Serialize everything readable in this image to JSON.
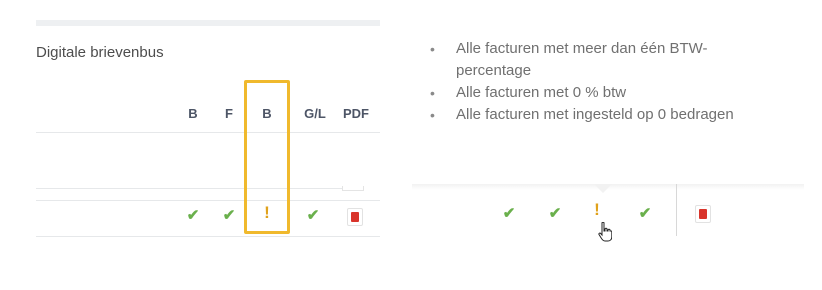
{
  "left": {
    "title": "Digitale brievenbus",
    "columns": [
      "B",
      "F",
      "B",
      "G/L",
      "PDF"
    ],
    "row_status": [
      "check",
      "check",
      "warning",
      "check",
      "pdf"
    ],
    "check_glyph": "✔",
    "warning_glyph": "!"
  },
  "tooltip": {
    "bullet": "•",
    "items": [
      "Alle facturen met meer dan één BTW-percentage",
      "Alle facturen met 0 % btw",
      "Alle facturen met ingesteld op 0 bedragen"
    ]
  },
  "right": {
    "row_status": [
      "check",
      "check",
      "warning",
      "check",
      "pdf"
    ]
  },
  "colors": {
    "check": "#6ab04c",
    "warning": "#e0a21c",
    "highlight": "#f0b92d",
    "pdf": "#d9342b"
  }
}
